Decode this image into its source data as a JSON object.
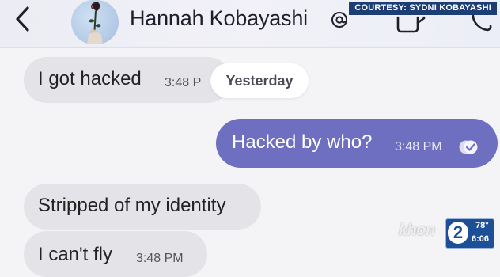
{
  "header": {
    "contact_name": "Hannah Kobayashi",
    "icons": [
      "back-chevron-icon",
      "avatar-rose-icon",
      "verified-at-icon",
      "video-call-icon",
      "phone-icon"
    ]
  },
  "courtesy": "COURTESY: SYDNI KOBAYASHI",
  "date_separator": "Yesterday",
  "messages": [
    {
      "direction": "received",
      "text": "I got hacked",
      "time": "3:48 P"
    },
    {
      "direction": "sent",
      "text": "Hacked by who?",
      "time": "3:48 PM",
      "status_icon": "read-check-icon"
    },
    {
      "direction": "received",
      "text": "Stripped of my identity"
    },
    {
      "direction": "received",
      "text": "I can't fly",
      "time": "3:48 PM"
    }
  ],
  "broadcast": {
    "logo": "khon",
    "channel": "2",
    "temperature": "78°",
    "time": "6:06"
  },
  "colors": {
    "sent_bubble": "#6f6fc2",
    "received_bubble": "#e4e4e8",
    "header_bg": "#ececf4",
    "badge_blue": "#1d4f97"
  }
}
